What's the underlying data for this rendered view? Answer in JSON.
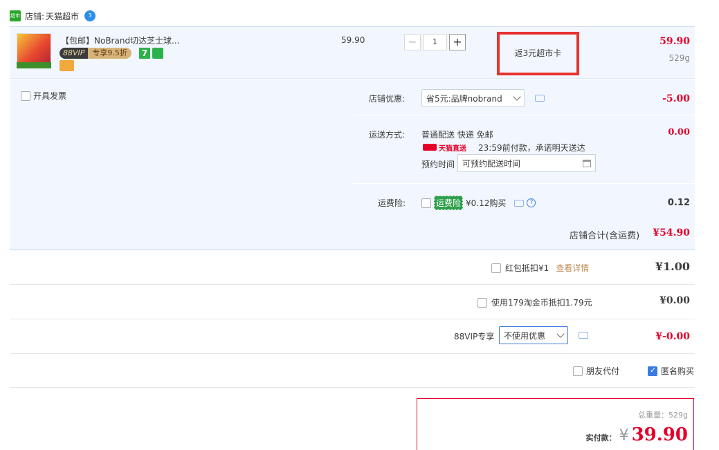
{
  "store": {
    "label": "店铺:",
    "name": "天猫超市",
    "logo_text": "超市",
    "wangwang": "3"
  },
  "item": {
    "title": "【包邮】NoBrand切达芝士球...",
    "vip_left": "88VIP",
    "vip_right": "专享9.5折",
    "tag_seven": "7",
    "unit_price": "59.90",
    "qty": "1",
    "minus": "−",
    "plus": "+",
    "rebate": "返3元超市卡",
    "subtotal": "59.90",
    "weight": "529g"
  },
  "invoice": {
    "label": "开具发票"
  },
  "shop_discount": {
    "label": "店铺优惠:",
    "value": "省5元:品牌nobrand",
    "amount": "-5.00"
  },
  "shipping": {
    "label": "运送方式:",
    "method": "普通配送 快递 免邮",
    "amount": "0.00",
    "direct_label": "天猫直送",
    "promise": "23:59前付款，承诺明天送达",
    "reserve_label": "预约时间",
    "reserve_placeholder": "可预约配送时间"
  },
  "insurance": {
    "label": "运费险:",
    "badge": "运费险",
    "text": "¥0.12购买",
    "amount": "0.12",
    "help": "?"
  },
  "store_total": {
    "label": "店铺合计(含运费)",
    "amount": "¥54.90"
  },
  "redpacket": {
    "label": "红包抵扣¥1",
    "link": "查看详情",
    "amount": "¥1.00"
  },
  "taojinbi": {
    "label": "使用179淘金币抵扣1.79元",
    "amount": "¥0.00"
  },
  "vip88": {
    "label": "88VIP专享",
    "select": "不使用优惠",
    "amount": "¥-0.00"
  },
  "options": {
    "friend_pay": "朋友代付",
    "anonymous": "匿名购买"
  },
  "summary": {
    "weight_label": "总重量：529g",
    "pay_label": "实付款：",
    "currency": "¥",
    "amount": "39.90"
  },
  "colors": {
    "accent_red": "#e4002b",
    "panel_bg": "#f2f7ff",
    "highlight_border": "#e8322e"
  }
}
